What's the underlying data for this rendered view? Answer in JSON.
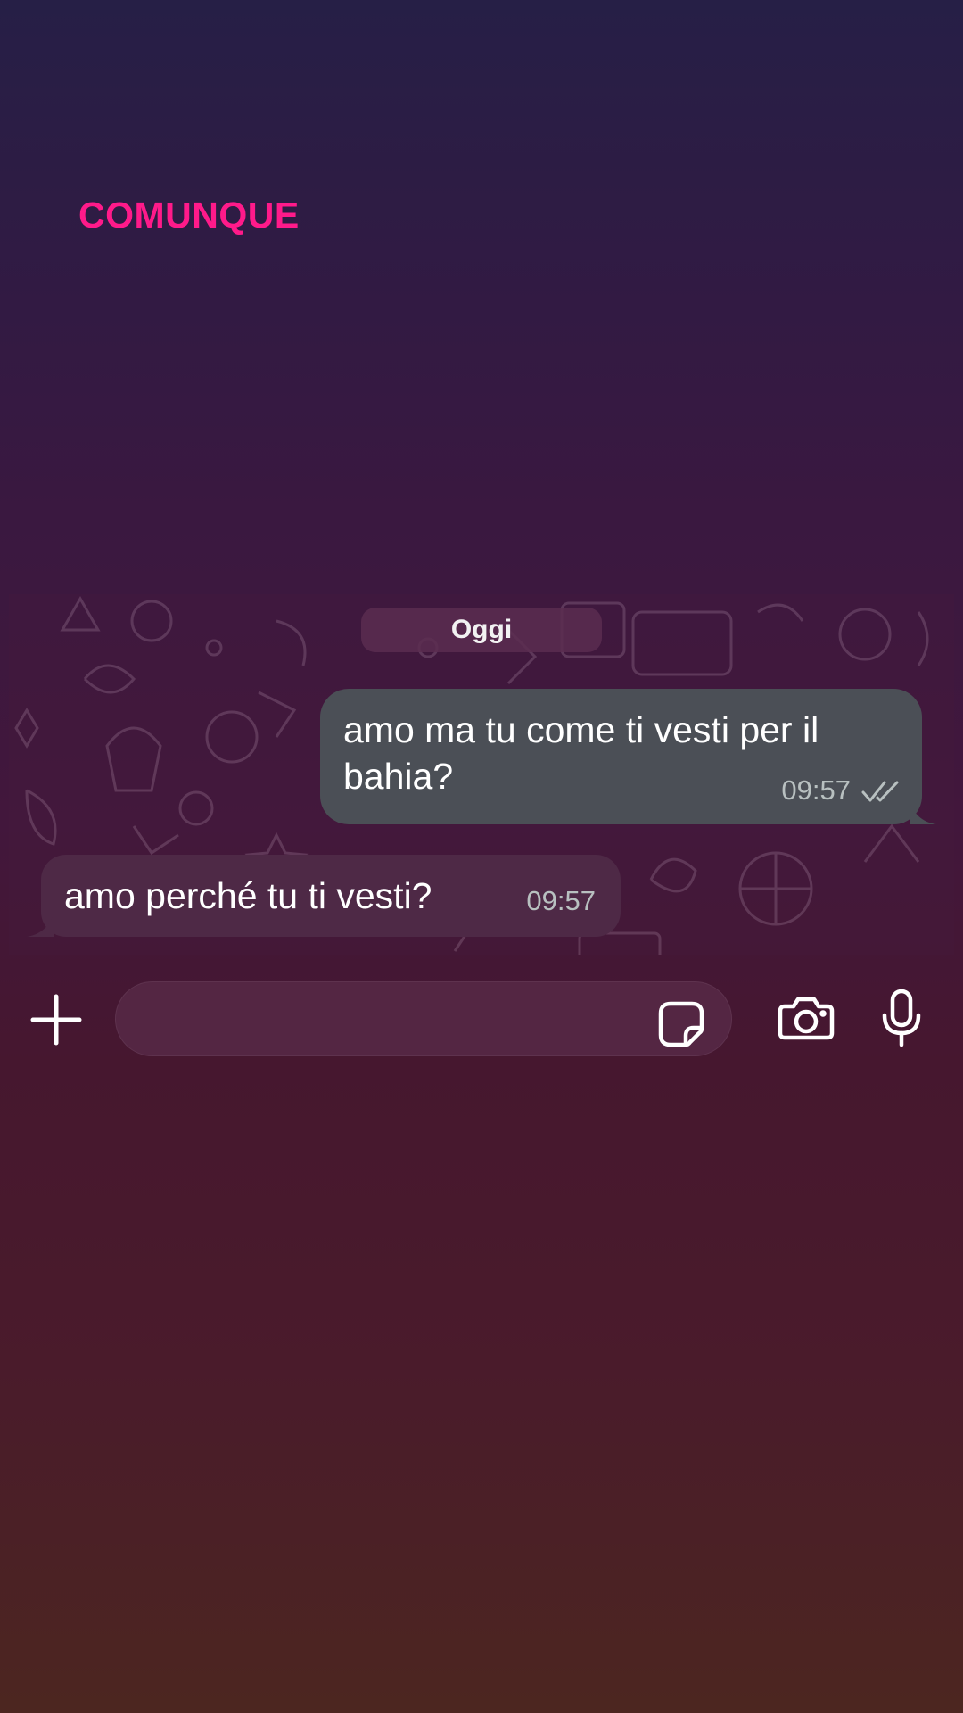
{
  "overlay": {
    "caption": "COMUNQUE"
  },
  "chat": {
    "date_label": "Oggi",
    "messages": [
      {
        "direction": "outgoing",
        "text": "amo ma tu come ti vesti per il bahia?",
        "time": "09:57",
        "status_icon": "double-check-icon"
      },
      {
        "direction": "incoming",
        "text": "amo perché tu ti vesti?",
        "time": "09:57"
      }
    ]
  },
  "composer": {
    "value": "",
    "placeholder": "",
    "icons": [
      "plus-icon",
      "sticker-icon",
      "camera-icon",
      "microphone-icon"
    ]
  },
  "colors": {
    "caption": "#ff1a8a",
    "outgoing_bubble": "#4b4f56",
    "incoming_bubble": "#4e2946",
    "input_field": "#542643"
  }
}
